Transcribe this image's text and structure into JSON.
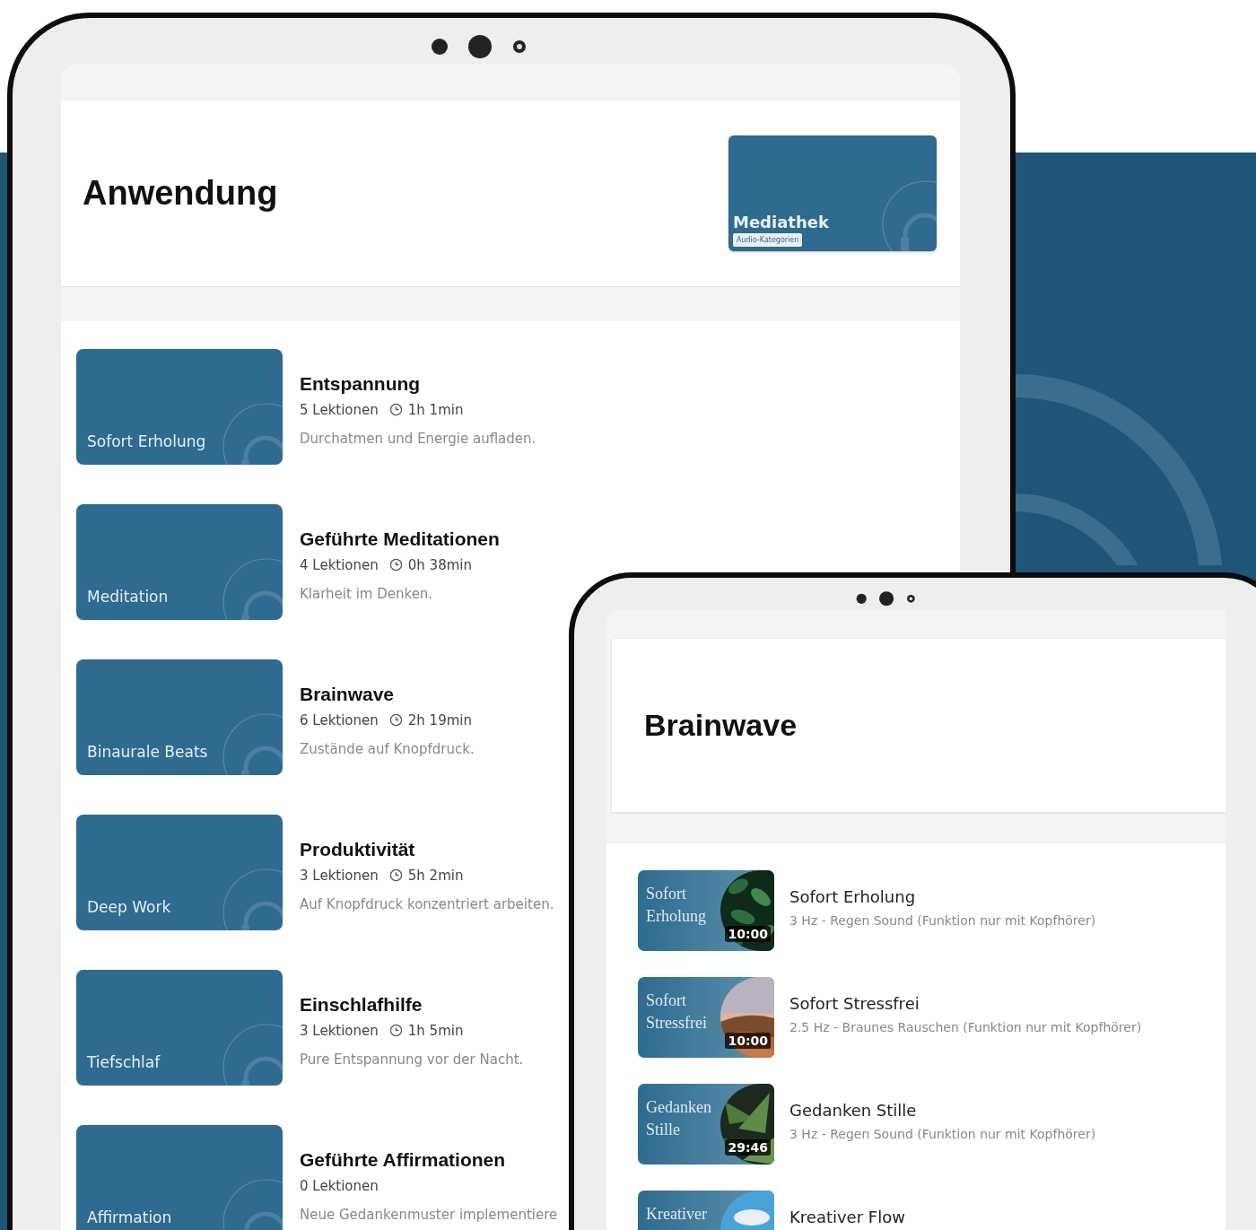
{
  "overview_screen": {
    "title": "Anwendung",
    "feature_card": {
      "title": "Mediathek",
      "tag": "Audio-Kategorien"
    },
    "courses": [
      {
        "thumbnail_label": "Sofort Erholung",
        "title": "Entspannung",
        "lessons": "5 Lektionen",
        "duration": "1h 1min",
        "description": "Durchatmen und Energie aufladen."
      },
      {
        "thumbnail_label": "Meditation",
        "title": "Geführte Meditationen",
        "lessons": "4 Lektionen",
        "duration": "0h 38min",
        "description": "Klarheit im Denken."
      },
      {
        "thumbnail_label": "Binaurale Beats",
        "title": "Brainwave",
        "lessons": "6 Lektionen",
        "duration": "2h 19min",
        "description": "Zustände auf Knopfdruck."
      },
      {
        "thumbnail_label": "Deep Work",
        "title": "Produktivität",
        "lessons": "3 Lektionen",
        "duration": "5h 2min",
        "description": "Auf Knopfdruck konzentriert arbeiten."
      },
      {
        "thumbnail_label": "Tiefschlaf",
        "title": "Einschlafhilfe",
        "lessons": "3 Lektionen",
        "duration": "1h 5min",
        "description": "Pure Entspannung vor der Nacht."
      },
      {
        "thumbnail_label": "Affirmation",
        "title": "Geführte Affirmationen",
        "lessons": "0 Lektionen",
        "description": "Neue Gedankenmuster implementiere"
      }
    ]
  },
  "detail_screen": {
    "title": "Brainwave",
    "tracks": [
      {
        "thumbnail_label": "Sofort Erholung",
        "duration": "10:00",
        "title": "Sofort Erholung",
        "subtitle": "3 Hz - Regen Sound (Funktion nur mit Kopfhörer)"
      },
      {
        "thumbnail_label": "Sofort Stressfrei",
        "duration": "10:00",
        "title": "Sofort Stressfrei",
        "subtitle": "2.5 Hz - Braunes Rauschen (Funktion nur mit Kopfhörer)"
      },
      {
        "thumbnail_label": "Gedanken Stille",
        "duration": "29:46",
        "title": "Gedanken Stille",
        "subtitle": "3 Hz - Regen Sound (Funktion nur mit Kopfhörer)"
      },
      {
        "thumbnail_label": "Kreativer",
        "title": "Kreativer Flow"
      }
    ]
  }
}
